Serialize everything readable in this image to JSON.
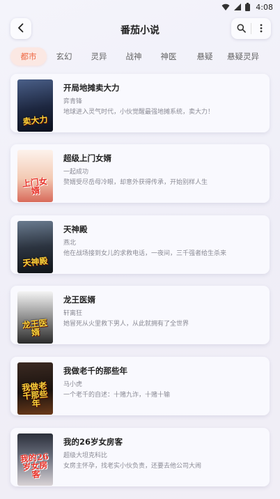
{
  "status": {
    "time": "4:08"
  },
  "header": {
    "title": "番茄小说"
  },
  "tabs": [
    {
      "label": "都市",
      "active": true
    },
    {
      "label": "玄幻",
      "active": false
    },
    {
      "label": "灵异",
      "active": false
    },
    {
      "label": "战神",
      "active": false
    },
    {
      "label": "神医",
      "active": false
    },
    {
      "label": "悬疑",
      "active": false
    },
    {
      "label": "悬疑灵异",
      "active": false
    }
  ],
  "books": [
    {
      "title": "开局地摊卖大力",
      "author": "弈青锋",
      "desc": "地球进入灵气时代，小伙觉醒最强地摊系统，卖大力！",
      "cover_text": "卖大力"
    },
    {
      "title": "超级上门女婿",
      "author": "一起成功",
      "desc": "赘婿受尽岳母冷眼，却意外获得传承，开始别样人生",
      "cover_text": "上门女婿"
    },
    {
      "title": "天神殿",
      "author": "燕北",
      "desc": "他在战场接到女儿的求救电话，一夜间，三千强者给生杀来",
      "cover_text": "天神殿"
    },
    {
      "title": "龙王医婿",
      "author": "轩离狂",
      "desc": "她冒死从火里救下男人，从此就拥有了全世界",
      "cover_text": "龙王医婿"
    },
    {
      "title": "我做老千的那些年",
      "author": "马小虎",
      "desc": "一个老千的自述：十赌九诈，十赌十输",
      "cover_text": "我做老千那些年"
    },
    {
      "title": "我的26岁女房客",
      "author": "超级大坦克科比",
      "desc": "女房主怀孕，找老实小伙负责，还要去他公司大闹",
      "cover_text": "我的26岁女房客"
    }
  ],
  "colors": {
    "accent": "#ef6a45",
    "accent_bg": "#fbe8e3",
    "background": "#f2f1f8",
    "card": "#fafafe"
  },
  "icons": {
    "status": [
      "wifi-icon",
      "signal-icon",
      "battery-icon"
    ],
    "header": [
      "back-arrow-icon",
      "search-icon",
      "more-vertical-icon"
    ]
  }
}
